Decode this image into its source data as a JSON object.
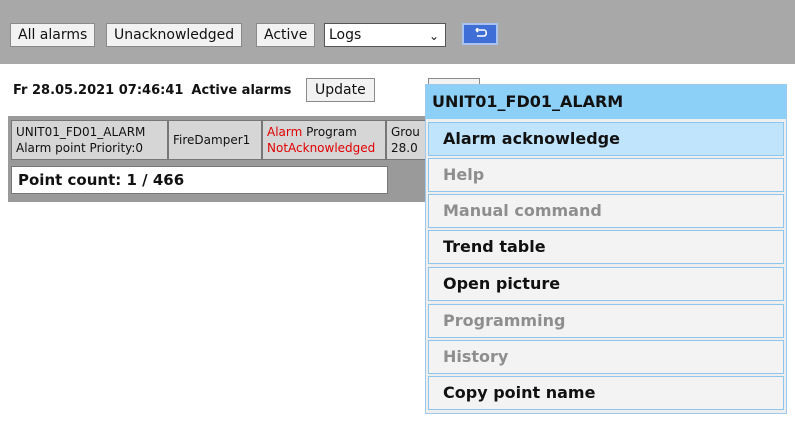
{
  "toolbar": {
    "all_alarms": "All alarms",
    "unacknowledged": "Unacknowledged",
    "active": "Active",
    "view_select": "Logs",
    "back_icon": "return-arrow-icon"
  },
  "status": {
    "datetime": "Fr 28.05.2021 07:46:41",
    "label": "Active alarms",
    "update_button": "Update"
  },
  "table": {
    "row": {
      "point_name": "UNIT01_FD01_ALARM",
      "point_detail": "Alarm point Priority:0",
      "device": "FireDamper1",
      "alarm_word": "Alarm",
      "type": "Program",
      "ack_status": "NotAcknowledged",
      "group_partial": "Grou",
      "date_partial": "28.0"
    },
    "point_count": "Point count: 1 / 466"
  },
  "context_menu": {
    "title": "UNIT01_FD01_ALARM",
    "items": [
      {
        "label": "Alarm acknowledge",
        "state": "selected"
      },
      {
        "label": "Help",
        "state": "disabled"
      },
      {
        "label": "Manual command",
        "state": "disabled"
      },
      {
        "label": "Trend table",
        "state": "enabled"
      },
      {
        "label": "Open picture",
        "state": "enabled"
      },
      {
        "label": "Programming",
        "state": "disabled"
      },
      {
        "label": "History",
        "state": "disabled"
      },
      {
        "label": "Copy point name",
        "state": "enabled"
      }
    ]
  },
  "colors": {
    "toolbar_bg": "#a8a8a8",
    "accent_blue": "#3f6fd6",
    "menu_title_bg": "#8dd0f7",
    "menu_selected_bg": "#bfe4fb",
    "alarm_red": "#e00000"
  }
}
